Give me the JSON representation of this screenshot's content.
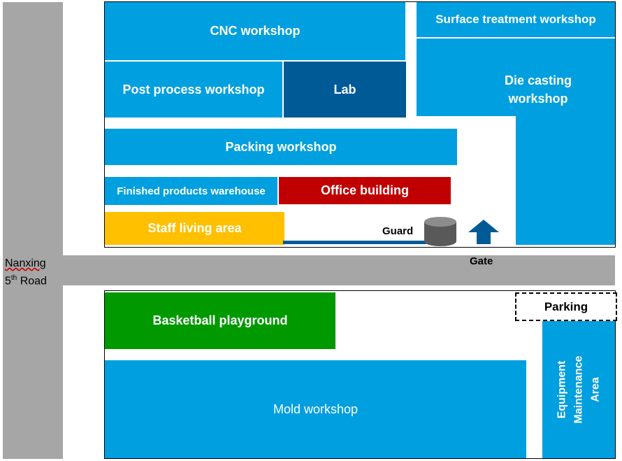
{
  "roads": {
    "vertical_label_line1": "Nanxing",
    "vertical_label_line2_num": "5",
    "vertical_label_line2_sup": "th",
    "vertical_label_line2_rest": " Road",
    "gate_label": "Gate"
  },
  "north_zone": {
    "cnc": "CNC workshop",
    "surface": "Surface treatment workshop",
    "post_process": "Post process workshop",
    "lab": "Lab",
    "die_casting_line1": "Die casting",
    "die_casting_line2": "workshop",
    "packing": "Packing workshop",
    "finished_warehouse": "Finished products warehouse",
    "office": "Office building",
    "staff_living": "Staff living  area",
    "guard": "Guard"
  },
  "south_zone": {
    "parking": "Parking",
    "basketball": "Basketball playground",
    "mold": "Mold workshop",
    "equipment_line1": "Equipment",
    "equipment_line2": "Maintenance",
    "equipment_line3": "Area"
  },
  "colors": {
    "workshop_blue": "#009fdf",
    "lab_navy": "#005a96",
    "office_red": "#c00000",
    "staff_yellow": "#ffc000",
    "basketball_green": "#009900",
    "road_gray": "#a6a6a6",
    "guard_gray": "#595959"
  }
}
